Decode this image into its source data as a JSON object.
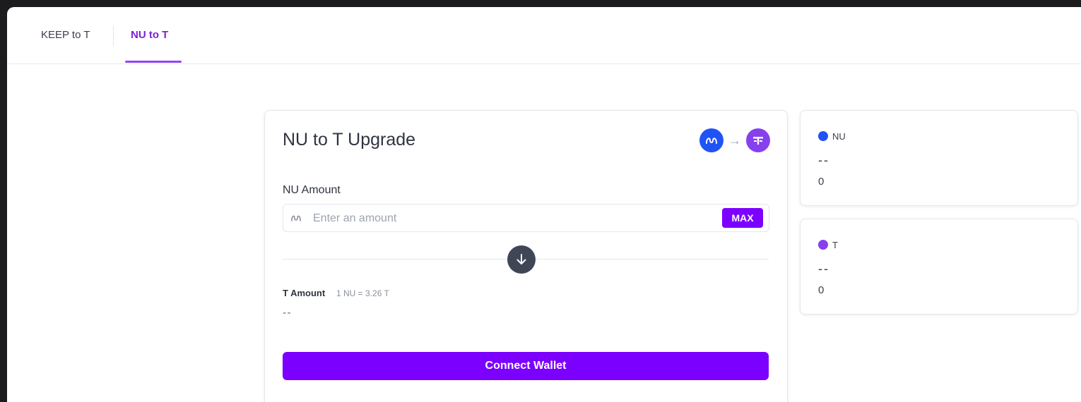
{
  "tabs": [
    {
      "label": "KEEP to T",
      "active": false
    },
    {
      "label": "NU to T",
      "active": true
    }
  ],
  "upgrade_card": {
    "title": "NU to T Upgrade",
    "from_token_icon": "nu-token-icon",
    "to_token_icon": "t-token-icon",
    "nu_amount_label": "NU Amount",
    "amount_input": {
      "value": "",
      "placeholder": "Enter an amount"
    },
    "max_button": "MAX",
    "t_amount_label": "T Amount",
    "rate": "1 NU = 3.26 T",
    "t_amount_value": "--",
    "connect_button": "Connect Wallet"
  },
  "balances": [
    {
      "token": "NU",
      "value": "--",
      "secondary": "0"
    },
    {
      "token": "T",
      "value": "--",
      "secondary": "0"
    }
  ],
  "colors": {
    "accent": "#7b00ff",
    "nu_blue": "#1f53f5",
    "t_purple": "#8740ee",
    "active_tab": "#7b1fd9"
  }
}
